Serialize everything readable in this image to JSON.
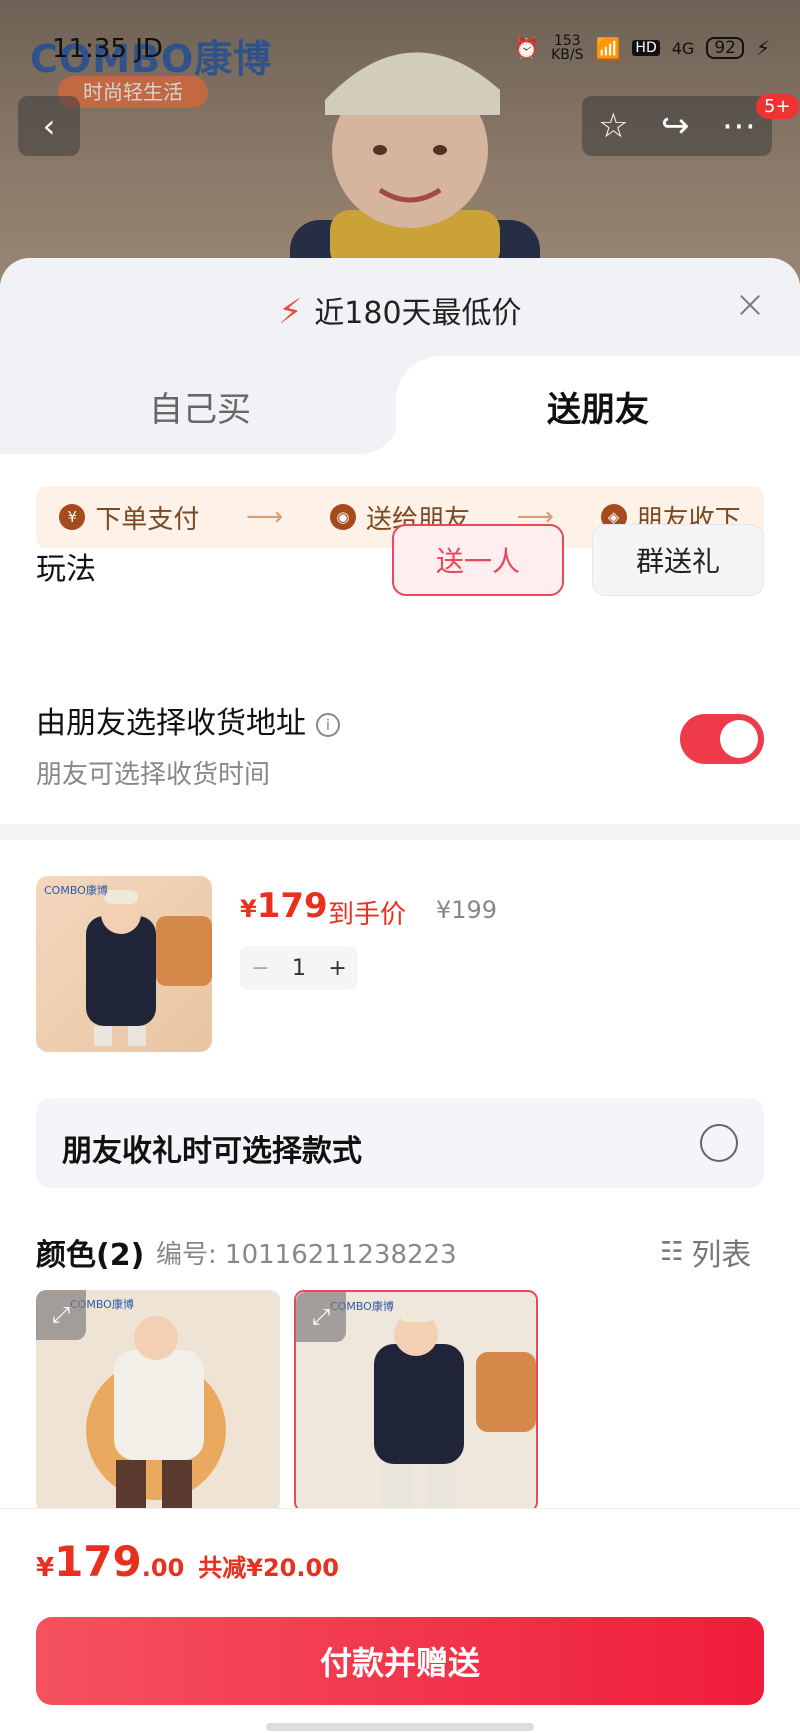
{
  "status_bar": {
    "time": "11:35",
    "carrier": "JD",
    "net_speed": "153",
    "net_unit": "KB/S",
    "hd": "HD",
    "signal": "4G",
    "battery": "92"
  },
  "hero": {
    "brand": "COMBO康博",
    "brand_tagline": "时尚轻生活",
    "badge": "5+"
  },
  "sheet": {
    "title": "近180天最低价",
    "tabs": [
      {
        "label": "自己买"
      },
      {
        "label": "送朋友"
      }
    ],
    "steps": [
      {
        "icon": "¥",
        "label": "下单支付"
      },
      {
        "icon": "◉",
        "label": "送给朋友"
      },
      {
        "icon": "🎁",
        "label": "朋友收下"
      }
    ],
    "play": {
      "label": "玩法",
      "options": [
        {
          "label": "送一人",
          "selected": true
        },
        {
          "label": "群送礼",
          "selected": false
        }
      ]
    },
    "address": {
      "title": "由朋友选择收货地址",
      "subtitle": "朋友可选择收货时间",
      "toggle_on": true
    }
  },
  "product": {
    "price_symbol": "¥",
    "price": "179",
    "price_tag": "到手价",
    "original_price": "¥199",
    "quantity": "1",
    "minus": "−",
    "plus": "+"
  },
  "style_option": {
    "label": "朋友收礼时可选择款式"
  },
  "colors": {
    "title": "颜色(2)",
    "code": "编号: 10116211238223",
    "list_label": "列表"
  },
  "footer": {
    "symbol": "¥",
    "total_int": "179",
    "total_dec": ".00",
    "saving": "共减¥20.00",
    "pay_button": "付款并赠送"
  },
  "colors_theme": {
    "accent": "#ef1d3a",
    "price": "#e8301f",
    "toggle": "#ef3a4a"
  }
}
